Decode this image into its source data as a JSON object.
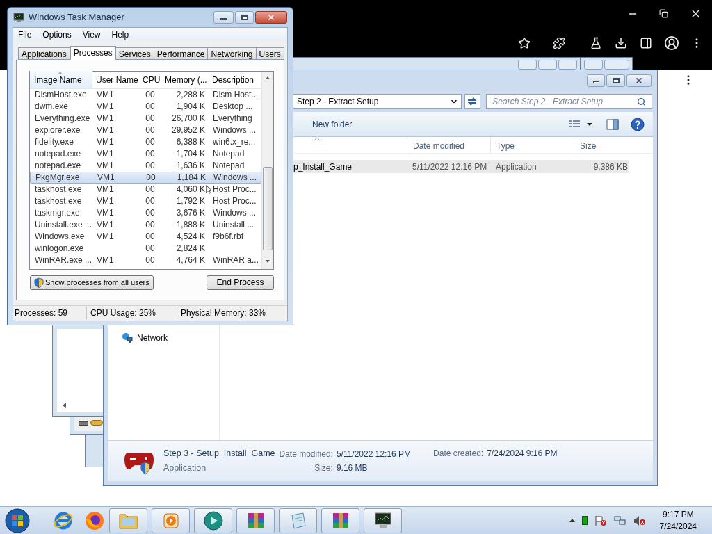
{
  "task_manager": {
    "title": "Windows Task Manager",
    "menu": [
      "File",
      "Options",
      "View",
      "Help"
    ],
    "tabs": [
      {
        "label": "Applications",
        "selected": false
      },
      {
        "label": "Processes",
        "selected": true
      },
      {
        "label": "Services",
        "selected": false
      },
      {
        "label": "Performance",
        "selected": false
      },
      {
        "label": "Networking",
        "selected": false
      },
      {
        "label": "Users",
        "selected": false
      }
    ],
    "columns": [
      "Image Name",
      "User Name",
      "CPU",
      "Memory (...",
      "Description"
    ],
    "rows": [
      {
        "image_name": "DismHost.exe",
        "user_name": "VM1",
        "cpu": "00",
        "memory": "2,288 K",
        "description": "Dism Host...",
        "selected": false
      },
      {
        "image_name": "dwm.exe",
        "user_name": "VM1",
        "cpu": "00",
        "memory": "1,904 K",
        "description": "Desktop ...",
        "selected": false
      },
      {
        "image_name": "Everything.exe",
        "user_name": "VM1",
        "cpu": "00",
        "memory": "26,700 K",
        "description": "Everything",
        "selected": false
      },
      {
        "image_name": "explorer.exe",
        "user_name": "VM1",
        "cpu": "00",
        "memory": "29,952 K",
        "description": "Windows ...",
        "selected": false
      },
      {
        "image_name": "fidelity.exe",
        "user_name": "VM1",
        "cpu": "00",
        "memory": "6,388 K",
        "description": "win6.x_re...",
        "selected": false
      },
      {
        "image_name": "notepad.exe",
        "user_name": "VM1",
        "cpu": "00",
        "memory": "1,704 K",
        "description": "Notepad",
        "selected": false
      },
      {
        "image_name": "notepad.exe",
        "user_name": "VM1",
        "cpu": "00",
        "memory": "1,636 K",
        "description": "Notepad",
        "selected": false
      },
      {
        "image_name": "PkgMgr.exe",
        "user_name": "VM1",
        "cpu": "00",
        "memory": "1,184 K",
        "description": "Windows ...",
        "selected": true
      },
      {
        "image_name": "taskhost.exe",
        "user_name": "VM1",
        "cpu": "00",
        "memory": "4,060 K",
        "description": "Host Proc...",
        "selected": false
      },
      {
        "image_name": "taskhost.exe",
        "user_name": "VM1",
        "cpu": "00",
        "memory": "1,792 K",
        "description": "Host Proc...",
        "selected": false
      },
      {
        "image_name": "taskmgr.exe",
        "user_name": "VM1",
        "cpu": "00",
        "memory": "3,676 K",
        "description": "Windows ...",
        "selected": false
      },
      {
        "image_name": "Uninstall.exe ...",
        "user_name": "VM1",
        "cpu": "00",
        "memory": "1,888 K",
        "description": "Uninstall ...",
        "selected": false
      },
      {
        "image_name": "Windows.exe",
        "user_name": "VM1",
        "cpu": "00",
        "memory": "4,524 K",
        "description": "f9b6f.rbf",
        "selected": false
      },
      {
        "image_name": "winlogon.exe",
        "cpu": "00",
        "memory": "2,824 K",
        "selected": false
      },
      {
        "image_name": "WinRAR.exe ...",
        "user_name": "VM1",
        "cpu": "00",
        "memory": "4,764 K",
        "description": "WinRAR a...",
        "selected": false
      }
    ],
    "buttons": [
      "Show processes from all users",
      "End Process"
    ],
    "status_bar": [
      "Processes: 59",
      "CPU Usage: 25%",
      "Physical Memory: 33%"
    ]
  },
  "explorer": {
    "address": "Step 2 - Extract Setup",
    "search_placeholder": "Search Step 2 - Extract Setup",
    "toolbar": [
      "New folder"
    ],
    "columns": [
      "Date modified",
      "Type",
      "Size"
    ],
    "files": [
      {
        "name": "p_Install_Game",
        "date_modified": "5/11/2022 12:16 PM",
        "type": "Application",
        "size": "9,386 KB",
        "selected": true
      }
    ],
    "nav": [
      "Network"
    ],
    "details": {
      "name": "Step 3 - Setup_Install_Game",
      "type": "Application",
      "date_modified_label": "Date modified:",
      "date_modified": "5/11/2022 12:16 PM",
      "size_label": "Size:",
      "size": "9.16 MB",
      "date_created_label": "Date created:",
      "date_created": "7/24/2024 9:16 PM"
    }
  },
  "taskbar": {
    "time": "9:17 PM",
    "date": "7/24/2024"
  }
}
